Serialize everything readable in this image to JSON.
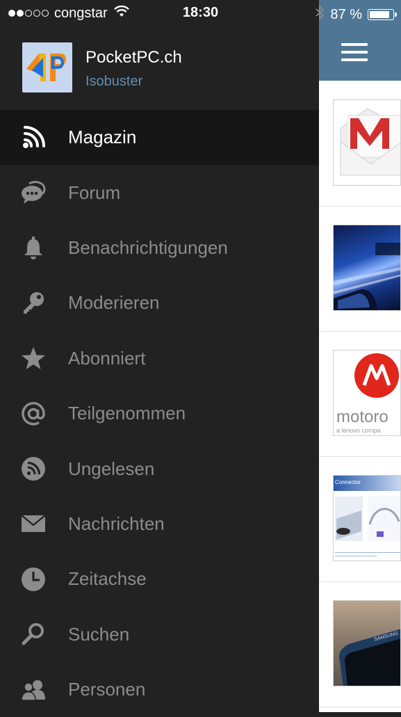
{
  "status_bar": {
    "carrier": "congstar",
    "time": "18:30",
    "battery_percent": "87 %",
    "battery_level": 0.87,
    "signal_bars_filled": 2,
    "signal_bars_total": 5
  },
  "profile": {
    "site_name": "PocketPC.ch",
    "user_name": "Isobuster"
  },
  "menu": {
    "active_index": 0,
    "items": [
      {
        "label": "Magazin",
        "icon": "rss-icon"
      },
      {
        "label": "Forum",
        "icon": "chat-bubbles-icon"
      },
      {
        "label": "Benachrichtigungen",
        "icon": "bell-icon"
      },
      {
        "label": "Moderieren",
        "icon": "key-icon"
      },
      {
        "label": "Abonniert",
        "icon": "star-icon"
      },
      {
        "label": "Teilgenommen",
        "icon": "at-sign-icon"
      },
      {
        "label": "Ungelesen",
        "icon": "rss-circle-icon"
      },
      {
        "label": "Nachrichten",
        "icon": "envelope-icon"
      },
      {
        "label": "Zeitachse",
        "icon": "clock-icon"
      },
      {
        "label": "Suchen",
        "icon": "search-icon"
      },
      {
        "label": "Personen",
        "icon": "people-icon"
      }
    ]
  },
  "content": {
    "articles": [
      {
        "thumb": "gmail-logo"
      },
      {
        "thumb": "car-night-speed-photo"
      },
      {
        "thumb": "motorola-logo",
        "text": "motoro",
        "subtext": "a lenovo compa"
      },
      {
        "thumb": "connector-screenshot",
        "text": "Connector"
      },
      {
        "thumb": "samsung-phone-photo",
        "text": "SAMSUNG"
      }
    ]
  },
  "colors": {
    "drawer_bg": "#222222",
    "active_item_bg": "#161616",
    "inactive_text": "#8c8c8c",
    "username_blue": "#5e8fb3",
    "topbar_blue": "#4f7795"
  }
}
